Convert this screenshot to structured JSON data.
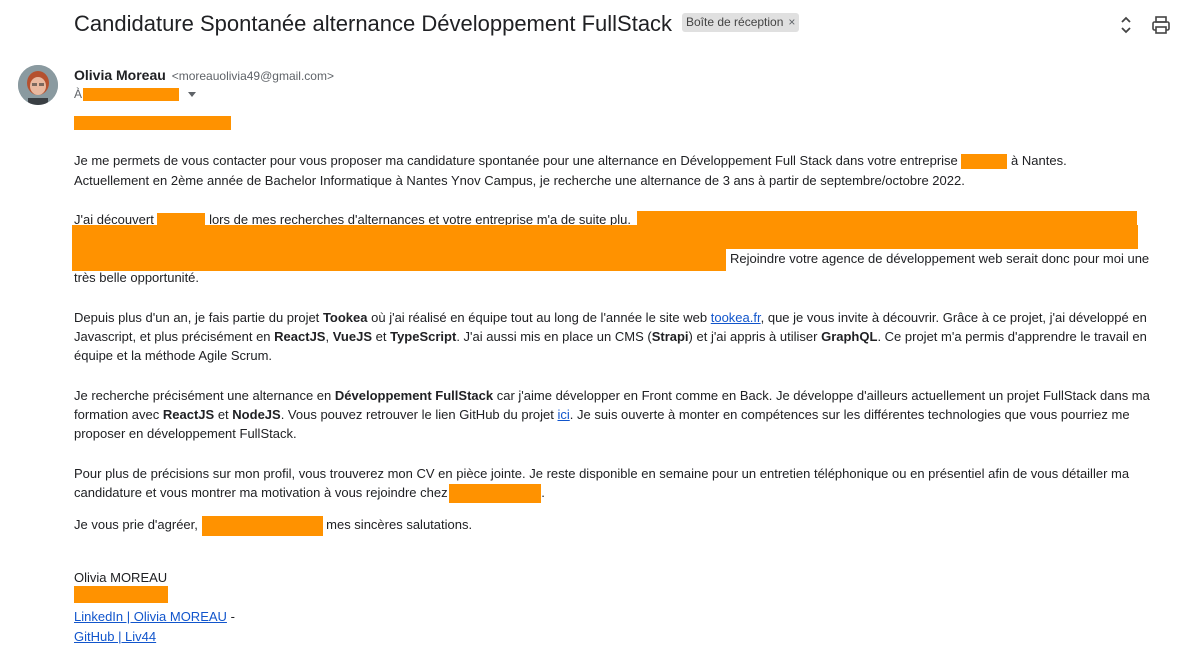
{
  "email": {
    "subject": "Candidature Spontanée alternance Développement FullStack",
    "label": "Boîte de réception",
    "label_close": "×",
    "sender_name": "Olivia Moreau",
    "sender_email": "<moreauolivia49@gmail.com>",
    "to_prefix": "À"
  },
  "body": {
    "p1_l1_a": "Je me permets de vous contacter pour vous proposer ma candidature spontanée pour une alternance en Développement Full Stack dans votre entreprise",
    "p1_l1_b": "à Nantes.",
    "p1_l2": "Actuellement en 2ème année de Bachelor Informatique à Nantes Ynov Campus, je recherche une alternance de 3 ans à partir de septembre/octobre 2022.",
    "p2_l1_a": "J'ai découvert",
    "p2_l1_b": "lors de mes recherches d'alternances et votre entreprise m'a de suite plu.",
    "p2_l3": "Rejoindre votre agence de développement web serait donc pour moi une",
    "p2_l4": "très belle opportunité.",
    "p3_l1_a": "Depuis plus d'un an, je fais partie du projet",
    "p3_l1_b": "Tookea",
    "p3_l1_c": "où j'ai réalisé en équipe tout au long de l'année le site web",
    "p3_link": "tookea.fr",
    "p3_l1_d": ", que je vous invite à découvrir. Grâce à ce projet, j'ai développé en",
    "p3_l2_a": "Javascript, et plus précisément en",
    "p3_l2_b": "ReactJS",
    "p3_l2_c": ",",
    "p3_l2_d": "VueJS",
    "p3_l2_e": "et",
    "p3_l2_f": "TypeScript",
    "p3_l2_g": ". J'ai aussi mis en place un CMS (",
    "p3_l2_h": "Strapi",
    "p3_l2_i": ") et j'ai appris à utiliser",
    "p3_l2_j": "GraphQL",
    "p3_l2_k": ". Ce projet m'a permis d'apprendre le travail en",
    "p3_l3": "équipe et la méthode Agile Scrum.",
    "p4_l1_a": "Je recherche précisément une alternance en",
    "p4_l1_b": "Développement FullStack",
    "p4_l1_c": "car j'aime développer en Front comme en Back. Je développe d'ailleurs actuellement un projet FullStack dans ma",
    "p4_l2_a": "formation avec",
    "p4_l2_b": "ReactJS",
    "p4_l2_c": "et",
    "p4_l2_d": "NodeJS",
    "p4_l2_e": ". Vous pouvez retrouver le lien GitHub du projet",
    "p4_link": "ici",
    "p4_l2_f": ". Je suis ouverte à monter en compétences sur les différentes technologies que vous pourriez me",
    "p4_l3": "proposer en développement FullStack.",
    "p5_l1": "Pour plus de précisions sur mon profil, vous trouverez mon CV en pièce jointe. Je reste disponible en semaine pour un entretien téléphonique ou en présentiel afin de vous détailler ma",
    "p5_l2_a": "candidature et vous montrer ma motivation à vous rejoindre chez",
    "p5_l2_b": ".",
    "p6_a": "Je vous prie d'agréer,",
    "p6_b": "mes sincères salutations.",
    "sig_name": "Olivia MOREAU",
    "sig_linkedin": "LinkedIn | Olivia MOREAU",
    "sig_dash": "-",
    "sig_github": "GitHub | Liv44"
  },
  "colors": {
    "redaction": "#ff9200",
    "link": "#1155cc"
  },
  "icons": [
    "expand-collapse-icon",
    "print-icon",
    "dropdown-caret-icon"
  ]
}
